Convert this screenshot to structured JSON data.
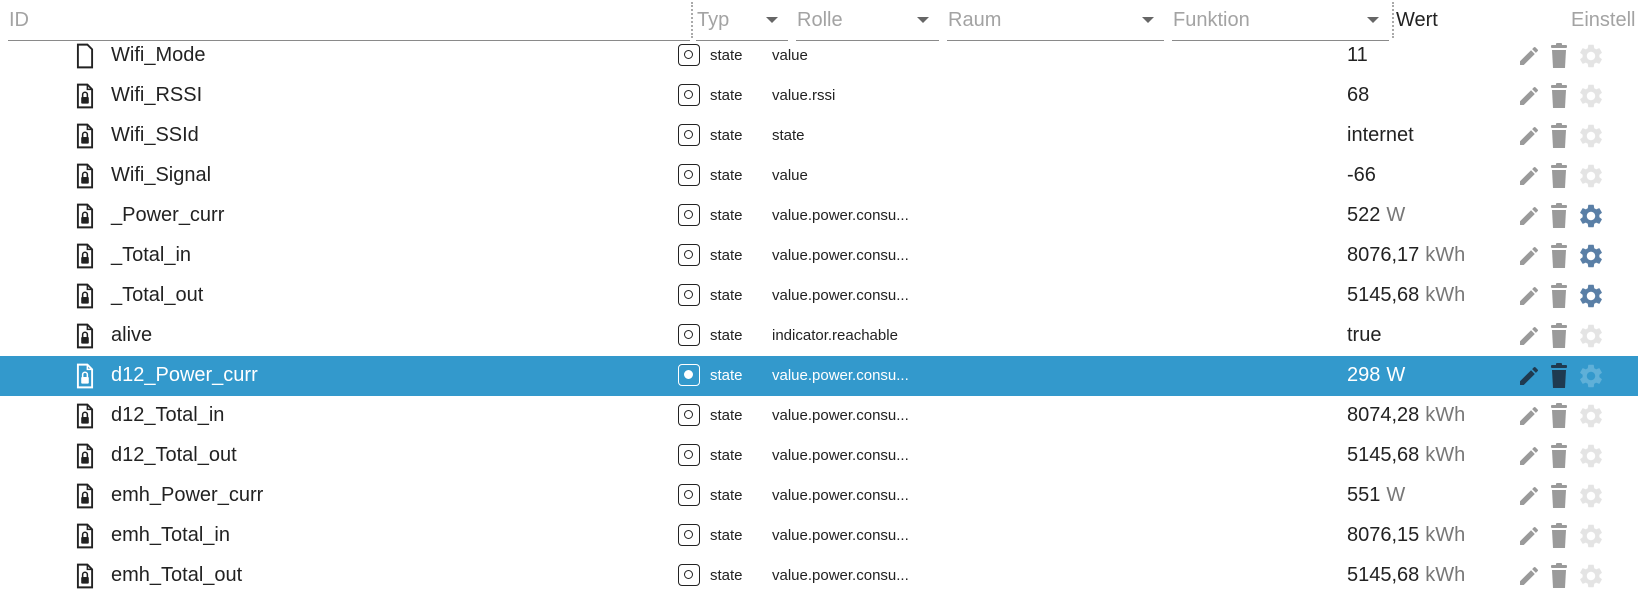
{
  "header": {
    "id_label": "ID",
    "typ_label": "Typ",
    "rolle_label": "Rolle",
    "raum_label": "Raum",
    "funktion_label": "Funktion",
    "wert_label": "Wert",
    "einstell_label": "Einstell"
  },
  "colors": {
    "selected_row": "#3399cc",
    "config_active": "#5a7fa6",
    "config_inactive": "#e4e4e4",
    "edit_icon": "#9a9a9a",
    "delete_icon": "#9a9a9a"
  },
  "rows": [
    {
      "name": "Wifi_Mode",
      "type": "state",
      "role": "value",
      "value": "11",
      "unit": "",
      "config_active": false,
      "selected": false
    },
    {
      "name": "Wifi_RSSI",
      "type": "state",
      "role": "value.rssi",
      "value": "68",
      "unit": "",
      "config_active": false,
      "selected": false
    },
    {
      "name": "Wifi_SSId",
      "type": "state",
      "role": "state",
      "value": "internet",
      "unit": "",
      "config_active": false,
      "selected": false
    },
    {
      "name": "Wifi_Signal",
      "type": "state",
      "role": "value",
      "value": "-66",
      "unit": "",
      "config_active": false,
      "selected": false
    },
    {
      "name": "_Power_curr",
      "type": "state",
      "role": "value.power.consu...",
      "value": "522",
      "unit": "W",
      "config_active": true,
      "selected": false
    },
    {
      "name": "_Total_in",
      "type": "state",
      "role": "value.power.consu...",
      "value": "8076,17",
      "unit": "kWh",
      "config_active": true,
      "selected": false
    },
    {
      "name": "_Total_out",
      "type": "state",
      "role": "value.power.consu...",
      "value": "5145,68",
      "unit": "kWh",
      "config_active": true,
      "selected": false
    },
    {
      "name": "alive",
      "type": "state",
      "role": "indicator.reachable",
      "value": "true",
      "unit": "",
      "config_active": false,
      "selected": false
    },
    {
      "name": "d12_Power_curr",
      "type": "state",
      "role": "value.power.consu...",
      "value": "298",
      "unit": "W",
      "config_active": false,
      "selected": true
    },
    {
      "name": "d12_Total_in",
      "type": "state",
      "role": "value.power.consu...",
      "value": "8074,28",
      "unit": "kWh",
      "config_active": false,
      "selected": false
    },
    {
      "name": "d12_Total_out",
      "type": "state",
      "role": "value.power.consu...",
      "value": "5145,68",
      "unit": "kWh",
      "config_active": false,
      "selected": false
    },
    {
      "name": "emh_Power_curr",
      "type": "state",
      "role": "value.power.consu...",
      "value": "551",
      "unit": "W",
      "config_active": false,
      "selected": false
    },
    {
      "name": "emh_Total_in",
      "type": "state",
      "role": "value.power.consu...",
      "value": "8076,15",
      "unit": "kWh",
      "config_active": false,
      "selected": false
    },
    {
      "name": "emh_Total_out",
      "type": "state",
      "role": "value.power.consu...",
      "value": "5145,68",
      "unit": "kWh",
      "config_active": false,
      "selected": false
    }
  ]
}
